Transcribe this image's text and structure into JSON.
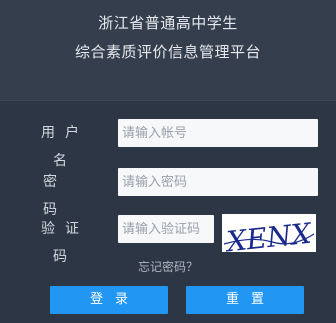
{
  "header": {
    "title_line1": "浙江省普通高中学生",
    "title_line2": "综合素质评价信息管理平台"
  },
  "form": {
    "username_label": "用户名",
    "username_placeholder": "请输入帐号",
    "password_label": "密码",
    "password_placeholder": "请输入密码",
    "captcha_label": "验证码",
    "captcha_placeholder": "请输入验证码",
    "captcha_text": "XENX"
  },
  "links": {
    "forgot_password": "忘记密码？"
  },
  "buttons": {
    "login": "登录",
    "reset": "重置"
  },
  "colors": {
    "page_bg": "#2d3644",
    "header_bg": "#353e4c",
    "accent": "#2196f3"
  }
}
